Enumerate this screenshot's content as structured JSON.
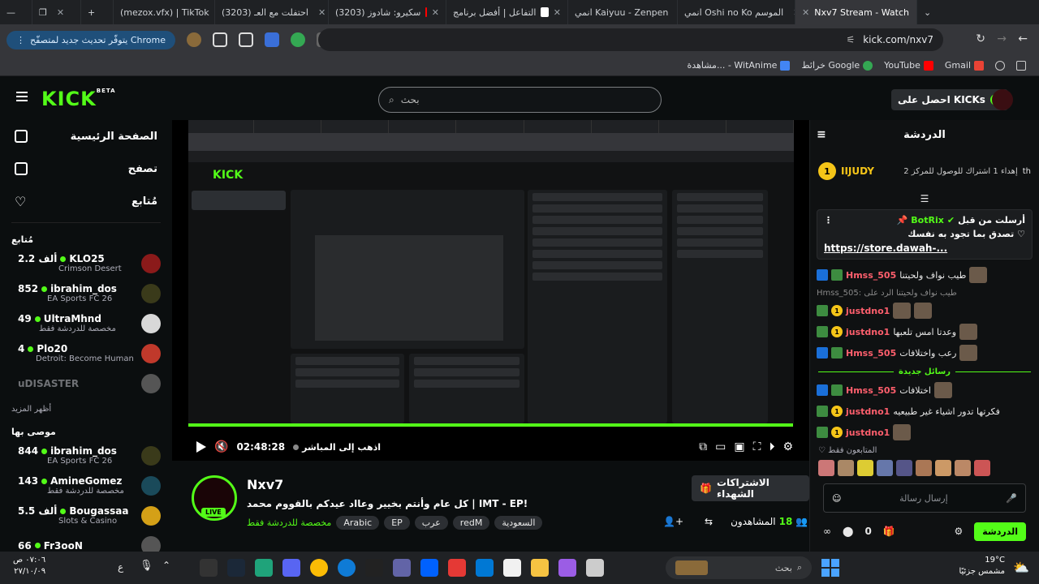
{
  "browser": {
    "tabs": [
      {
        "label": "(mezox.vfx) | TikTok",
        "color": "#000000"
      },
      {
        "label": "(3203) احتفلت مع العـ",
        "color": "#ff0000"
      },
      {
        "label": "(3203) سكيرو: شادوز",
        "color": "#ff0000"
      },
      {
        "label": "التفاعل | أفضل برنامج",
        "color": "#ffffff"
      },
      {
        "label": "انمي Kaiyuu - Zenpen",
        "color": "#e0314b"
      },
      {
        "label": "انمي Oshi no Ko الموسم",
        "color": "#e0314b"
      },
      {
        "label": "Nxv7 Stream - Watch",
        "color": "#53fc18",
        "active": true
      }
    ],
    "update_label": "يتوفّر تحديث جديد لمتصفّح Chrome",
    "url": "kick.com/nxv7",
    "bookmarks": [
      {
        "label": "Gmail",
        "color": "#ea4335"
      },
      {
        "label": "YouTube",
        "color": "#ff0000"
      },
      {
        "label": "خرائط Google",
        "color": "#34a853"
      },
      {
        "label": "مشاهدة... - WitAnime",
        "color": "#4285f4"
      }
    ]
  },
  "kick": {
    "logo": "KICK",
    "logo_sup": "BETA",
    "search_placeholder": "بحث",
    "get_kicks": "احصل على KICKs"
  },
  "sidebar": {
    "nav": [
      {
        "label": "الصفحة الرئيسية",
        "icon": "home-icon"
      },
      {
        "label": "تصفح",
        "icon": "browse-icon"
      },
      {
        "label": "مُتابع",
        "icon": "heart-icon"
      }
    ],
    "following_title": "مُتابع",
    "following": [
      {
        "name": "KLO25",
        "category": "Crimson Desert",
        "viewers": "2.2 ألف",
        "live": true,
        "color": "#8b1a1a"
      },
      {
        "name": "ibrahim_dos",
        "category": "EA Sports FC 26",
        "viewers": "852",
        "live": true,
        "color": "#3a3a1a"
      },
      {
        "name": "UltraMhnd",
        "category": "مخصصة للدردشة فقط",
        "viewers": "49",
        "live": true,
        "color": "#e8e8e8"
      },
      {
        "name": "Plo20",
        "category": "Detroit: Become Human",
        "viewers": "4",
        "live": true,
        "color": "#c0392b"
      },
      {
        "name": "uDISASTER",
        "category": "",
        "viewers": "",
        "live": false,
        "color": "#555555"
      }
    ],
    "show_more": "أظهر المزيد",
    "recommended_title": "موصى بها",
    "recommended": [
      {
        "name": "ibrahim_dos",
        "category": "EA Sports FC 26",
        "viewers": "844",
        "color": "#3a3a1a"
      },
      {
        "name": "AmineGomez",
        "category": "مخصصة للدردشة فقط",
        "viewers": "143",
        "color": "#1a4a5a"
      },
      {
        "name": "Bougassaa",
        "category": "Slots & Casino",
        "viewers": "5.5 ألف",
        "color": "#d4a017"
      },
      {
        "name": "Fr3ooN",
        "category": "",
        "viewers": "66",
        "color": "#555555"
      }
    ]
  },
  "player": {
    "time": "02:48:28",
    "go_live": "اذهب إلى المباشر",
    "progress": 1.0
  },
  "stream": {
    "channel": "Nxv7",
    "live_label": "LIVE",
    "title": "كل عام وأنتم بخيير وعااد عيدكم بالقووم محمد | IMT - EP!",
    "tags": [
      "السعودية",
      "redM",
      "عرب",
      "EP",
      "Arabic"
    ],
    "category": "مخصصة للدردشة فقط",
    "gift_label": "الاشتراكات الشهداء",
    "viewers_label": "المشاهدون",
    "viewers_count": "18"
  },
  "chat": {
    "title": "الدردشة",
    "goal_user": "IIJUDY",
    "goal_count": "1",
    "goal_text": "إهداء 1 اشتراك للوصول للمركز 2",
    "goal_level": "2",
    "goal_prefix": "th",
    "pinned_by": "أرسلت من قبل",
    "pinned_user": "BotRix",
    "pinned_msg": "تصدق بما تجود به نفسك",
    "pinned_link": "https://store.dawah-...",
    "messages": [
      {
        "user": "Hmss_505",
        "text": "طيب نواف ولحيتنا",
        "emote": true
      },
      {
        "user": "",
        "text": "Hmss_505: طيب نواف ولحيتنا الرد على",
        "reply": true
      },
      {
        "user": "justdno1",
        "text": "",
        "emote": true
      },
      {
        "user": "justdno1",
        "text": "وعدتا امس تلعبها",
        "emote": true
      },
      {
        "user": "Hmss_505",
        "text": "رعب واختلافات",
        "emote": true
      }
    ],
    "new_messages": "رسائل جديدة",
    "messages_after": [
      {
        "user": "Hmss_505",
        "text": "اختلافات",
        "emote": true
      },
      {
        "user": "justdno1",
        "text": "فكرتها تدور اشياء غير طبيعيه",
        "emote": false
      },
      {
        "user": "justdno1",
        "text": "",
        "emote": true
      }
    ],
    "followers_only": "المتابعون فقط",
    "input_placeholder": "إرسال رسالة",
    "points": "0",
    "send": "الدردشة"
  },
  "taskbar": {
    "search": "بحث",
    "temp": "19°C",
    "weather": "مشمس جزئيًا",
    "time": "٠٧:٠٦ ص",
    "date": "٢٧/١٠/٠٩"
  }
}
